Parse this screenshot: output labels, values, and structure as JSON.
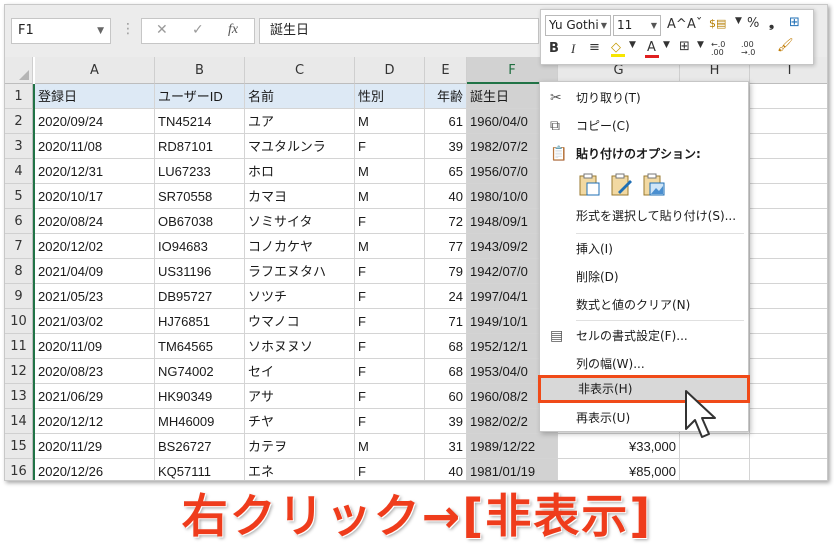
{
  "name_box": "F1",
  "formula_value": "誕生日",
  "formula_icons": {
    "cancel": "✕",
    "enter": "✓",
    "fx": "fx"
  },
  "column_headers": [
    "A",
    "B",
    "C",
    "D",
    "E",
    "F",
    "G",
    "H",
    "I"
  ],
  "table": {
    "headers": [
      "登録日",
      "ユーザーID",
      "名前",
      "性別",
      "年齢",
      "誕生日",
      ""
    ],
    "rows": [
      [
        "2020/09/24",
        "TN45214",
        "ユア",
        "M",
        "61",
        "1960/04/0",
        ""
      ],
      [
        "2020/11/08",
        "RD87101",
        "マユタルンラ",
        "F",
        "39",
        "1982/07/2",
        ""
      ],
      [
        "2020/12/31",
        "LU67233",
        "ホロ",
        "M",
        "65",
        "1956/07/0",
        ""
      ],
      [
        "2020/10/17",
        "SR70558",
        "カマヨ",
        "M",
        "40",
        "1980/10/0",
        ""
      ],
      [
        "2020/08/24",
        "OB67038",
        "ソミサイタ",
        "F",
        "72",
        "1948/09/1",
        ""
      ],
      [
        "2020/12/02",
        "IO94683",
        "コノカケヤ",
        "M",
        "77",
        "1943/09/2",
        ""
      ],
      [
        "2021/04/09",
        "US31196",
        "ラフエヌタハ",
        "F",
        "79",
        "1942/07/0",
        ""
      ],
      [
        "2021/05/23",
        "DB95727",
        "ソツチ",
        "F",
        "24",
        "1997/04/1",
        ""
      ],
      [
        "2021/03/02",
        "HJ76851",
        "ウマノコ",
        "F",
        "71",
        "1949/10/1",
        ""
      ],
      [
        "2020/11/09",
        "TM64565",
        "ソホヌヌソ",
        "F",
        "68",
        "1952/12/1",
        ""
      ],
      [
        "2020/08/23",
        "NG74002",
        "セイ",
        "F",
        "68",
        "1953/04/0",
        ""
      ],
      [
        "2021/06/29",
        "HK90349",
        "アサ",
        "F",
        "60",
        "1960/08/2",
        ""
      ],
      [
        "2020/12/12",
        "MH46009",
        "チヤ",
        "F",
        "39",
        "1982/02/2",
        ""
      ],
      [
        "2020/11/29",
        "BS26727",
        "カテヲ",
        "M",
        "31",
        "1989/12/22",
        "¥33,000"
      ],
      [
        "2020/12/26",
        "KQ57111",
        "エネ",
        "F",
        "40",
        "1981/01/19",
        "¥85,000"
      ]
    ]
  },
  "row_numbers": [
    "1",
    "2",
    "3",
    "4",
    "5",
    "6",
    "7",
    "8",
    "9",
    "10",
    "11",
    "12",
    "13",
    "14",
    "15",
    "16"
  ],
  "context_menu": {
    "cut": "切り取り(T)",
    "copy": "コピー(C)",
    "paste_options": "貼り付けのオプション:",
    "paste_special": "形式を選択して貼り付け(S)...",
    "insert": "挿入(I)",
    "delete": "削除(D)",
    "clear": "数式と値のクリア(N)",
    "format_cells": "セルの書式設定(F)...",
    "column_width": "列の幅(W)...",
    "hide": "非表示(H)",
    "unhide": "再表示(U)"
  },
  "mini_toolbar": {
    "font": "Yu Gothi",
    "size": "11",
    "grow": "A^",
    "shrink": "Aˇ",
    "percent": "%",
    "comma": "❟",
    "bold": "B",
    "italic": "I",
    "align": "≡",
    "font_color": "A",
    "inc_decimal": "←.0 .00",
    "dec_decimal": ".00 →.0"
  },
  "caption": "右クリック→[非表示]",
  "colors": {
    "accent": "#217346",
    "highlight_border": "#f04a18",
    "caption": "#ef3c1c",
    "header_fill": "#dde9f5",
    "selected_fill": "#d2d2d2"
  }
}
